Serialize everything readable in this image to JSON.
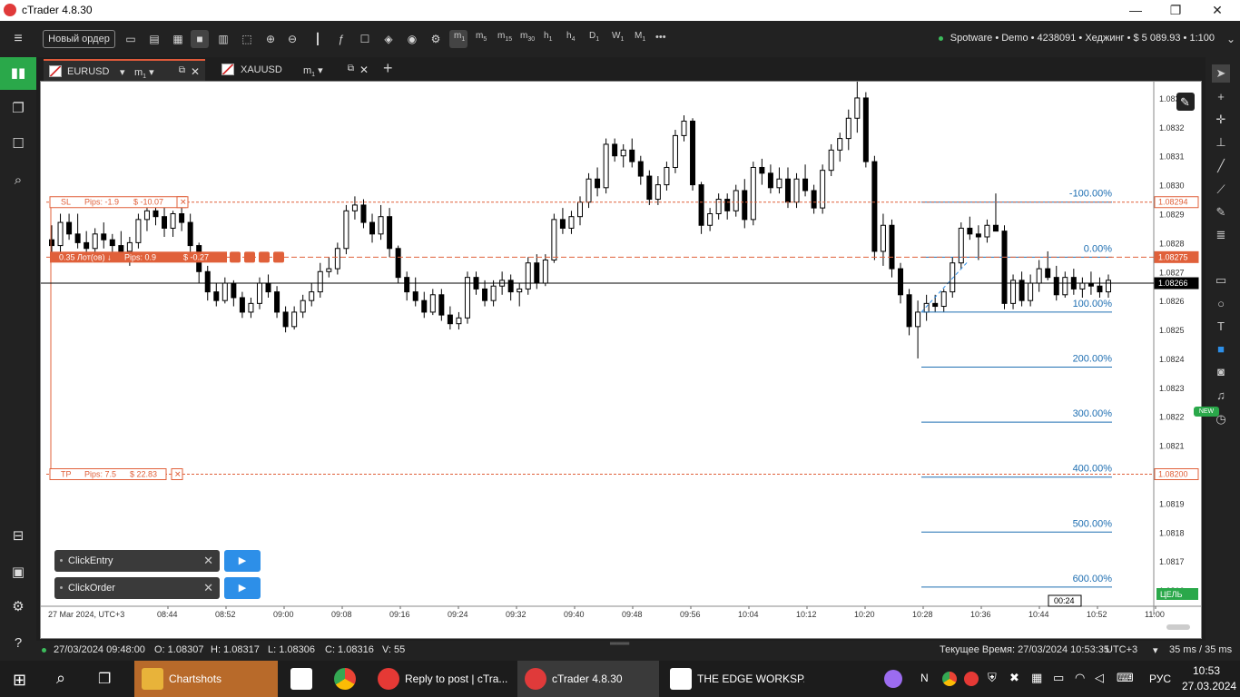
{
  "window": {
    "title": "cTrader 4.8.30",
    "minimize": "—",
    "maximize": "❐",
    "close": "✕"
  },
  "toolbar": {
    "new_order": "Новый ордер",
    "timeframes": [
      {
        "base": "m",
        "sub": "1"
      },
      {
        "base": "m",
        "sub": "5"
      },
      {
        "base": "m",
        "sub": "15"
      },
      {
        "base": "m",
        "sub": "30"
      },
      {
        "base": "h",
        "sub": "1"
      },
      {
        "base": "h",
        "sub": "4"
      },
      {
        "base": "D",
        "sub": "1"
      },
      {
        "base": "W",
        "sub": "1"
      },
      {
        "base": "M",
        "sub": "1"
      }
    ],
    "more": "•••",
    "account": "Spotware • Demo • 4238091 • Хеджинг • $ 5 089.93 • 1:100"
  },
  "tabs": [
    {
      "symbol": "EURUSD",
      "timeframe": "m",
      "timeframe_sub": "1",
      "active": true
    },
    {
      "symbol": "XAUUSD",
      "timeframe": "m",
      "timeframe_sub": "1",
      "active": false
    }
  ],
  "add_tab": "+",
  "chart_data": {
    "type": "candlestick",
    "symbol": "EURUSD",
    "timeframe": "m1",
    "ylim": [
      1.08155,
      1.08335
    ],
    "y_ticks": [
      "1.0833",
      "1.0832",
      "1.0831",
      "1.0830",
      "1.0829",
      "1.0828",
      "1.0827",
      "1.0826",
      "1.0825",
      "1.0824",
      "1.0823",
      "1.0822",
      "1.0821",
      "1.0820",
      "1.0819",
      "1.0818",
      "1.0817",
      "1.0816"
    ],
    "x_ticks": [
      "27 Mar 2024, UTC+3",
      "08:44",
      "08:52",
      "09:00",
      "09:08",
      "09:16",
      "09:24",
      "09:32",
      "09:40",
      "09:48",
      "09:56",
      "10:04",
      "10:12",
      "10:20",
      "10:28",
      "10:36",
      "10:44",
      "10:52",
      "11:00"
    ],
    "candles": [
      [
        1.08281,
        1.08286,
        1.08275,
        1.08279
      ],
      [
        1.08279,
        1.0829,
        1.08275,
        1.08287
      ],
      [
        1.08287,
        1.0829,
        1.08281,
        1.08283
      ],
      [
        1.08283,
        1.0829,
        1.08278,
        1.0828
      ],
      [
        1.0828,
        1.08284,
        1.08276,
        1.08278
      ],
      [
        1.08278,
        1.08285,
        1.08275,
        1.08283
      ],
      [
        1.08283,
        1.08287,
        1.08278,
        1.08281
      ],
      [
        1.08281,
        1.08283,
        1.08276,
        1.08279
      ],
      [
        1.08279,
        1.08284,
        1.08275,
        1.08277
      ],
      [
        1.08277,
        1.08282,
        1.08272,
        1.0828
      ],
      [
        1.0828,
        1.0829,
        1.08278,
        1.08288
      ],
      [
        1.08288,
        1.08294,
        1.08284,
        1.08291
      ],
      [
        1.08291,
        1.08294,
        1.08286,
        1.08289
      ],
      [
        1.08289,
        1.08293,
        1.08282,
        1.08285
      ],
      [
        1.08285,
        1.08291,
        1.08282,
        1.0829
      ],
      [
        1.0829,
        1.08294,
        1.08284,
        1.08287
      ],
      [
        1.08287,
        1.0829,
        1.08276,
        1.08279
      ],
      [
        1.08279,
        1.0828,
        1.08266,
        1.0827
      ],
      [
        1.0827,
        1.08272,
        1.0826,
        1.08263
      ],
      [
        1.08263,
        1.08266,
        1.08258,
        1.0826
      ],
      [
        1.0826,
        1.08268,
        1.08259,
        1.08266
      ],
      [
        1.08266,
        1.08267,
        1.08258,
        1.08261
      ],
      [
        1.08261,
        1.08263,
        1.08254,
        1.08256
      ],
      [
        1.08256,
        1.08261,
        1.08254,
        1.08259
      ],
      [
        1.08259,
        1.08268,
        1.08257,
        1.08266
      ],
      [
        1.08266,
        1.08269,
        1.08261,
        1.08263
      ],
      [
        1.08263,
        1.08265,
        1.08254,
        1.08256
      ],
      [
        1.08256,
        1.08258,
        1.08249,
        1.08251
      ],
      [
        1.08251,
        1.08258,
        1.0825,
        1.08256
      ],
      [
        1.08256,
        1.08262,
        1.08254,
        1.0826
      ],
      [
        1.0826,
        1.08266,
        1.08258,
        1.08263
      ],
      [
        1.08263,
        1.08273,
        1.08261,
        1.0827
      ],
      [
        1.0827,
        1.08275,
        1.08268,
        1.08271
      ],
      [
        1.08271,
        1.0828,
        1.08269,
        1.08278
      ],
      [
        1.08278,
        1.08293,
        1.08276,
        1.08291
      ],
      [
        1.08291,
        1.08296,
        1.08288,
        1.08293
      ],
      [
        1.08293,
        1.08295,
        1.08285,
        1.08287
      ],
      [
        1.08287,
        1.0829,
        1.0828,
        1.08283
      ],
      [
        1.08283,
        1.08293,
        1.08281,
        1.08289
      ],
      [
        1.08289,
        1.08292,
        1.08275,
        1.08278
      ],
      [
        1.08278,
        1.08279,
        1.08266,
        1.08268
      ],
      [
        1.08268,
        1.0827,
        1.0826,
        1.08263
      ],
      [
        1.08263,
        1.08268,
        1.08258,
        1.0826
      ],
      [
        1.0826,
        1.08263,
        1.08254,
        1.08256
      ],
      [
        1.08256,
        1.08264,
        1.08255,
        1.08262
      ],
      [
        1.08262,
        1.08264,
        1.08253,
        1.08255
      ],
      [
        1.08255,
        1.08258,
        1.0825,
        1.08252
      ],
      [
        1.08252,
        1.08256,
        1.0825,
        1.08254
      ],
      [
        1.08254,
        1.0827,
        1.08252,
        1.08268
      ],
      [
        1.08268,
        1.0827,
        1.08262,
        1.08264
      ],
      [
        1.08264,
        1.08267,
        1.08258,
        1.0826
      ],
      [
        1.0826,
        1.08267,
        1.08258,
        1.08265
      ],
      [
        1.08265,
        1.0827,
        1.08262,
        1.08267
      ],
      [
        1.08267,
        1.08269,
        1.0826,
        1.08263
      ],
      [
        1.08263,
        1.08266,
        1.08258,
        1.08264
      ],
      [
        1.08264,
        1.08275,
        1.08262,
        1.08273
      ],
      [
        1.08273,
        1.08276,
        1.08264,
        1.08266
      ],
      [
        1.08266,
        1.08276,
        1.08265,
        1.08274
      ],
      [
        1.08274,
        1.0829,
        1.08273,
        1.08288
      ],
      [
        1.08288,
        1.08292,
        1.08283,
        1.08285
      ],
      [
        1.08285,
        1.08291,
        1.08283,
        1.08289
      ],
      [
        1.08289,
        1.08296,
        1.08286,
        1.08294
      ],
      [
        1.08294,
        1.08304,
        1.08292,
        1.08302
      ],
      [
        1.08302,
        1.08306,
        1.08296,
        1.08299
      ],
      [
        1.08299,
        1.08316,
        1.08297,
        1.08314
      ],
      [
        1.08314,
        1.08316,
        1.08308,
        1.0831
      ],
      [
        1.0831,
        1.08314,
        1.08306,
        1.08312
      ],
      [
        1.08312,
        1.08316,
        1.08306,
        1.08308
      ],
      [
        1.08308,
        1.0831,
        1.083,
        1.08303
      ],
      [
        1.08303,
        1.08305,
        1.08293,
        1.08295
      ],
      [
        1.08295,
        1.08303,
        1.08293,
        1.083
      ],
      [
        1.083,
        1.08308,
        1.08298,
        1.08306
      ],
      [
        1.08306,
        1.08319,
        1.08304,
        1.08317
      ],
      [
        1.08317,
        1.08324,
        1.08315,
        1.08322
      ],
      [
        1.08322,
        1.08323,
        1.08298,
        1.083
      ],
      [
        1.083,
        1.08301,
        1.08283,
        1.08286
      ],
      [
        1.08286,
        1.08292,
        1.08284,
        1.0829
      ],
      [
        1.0829,
        1.08297,
        1.08288,
        1.08295
      ],
      [
        1.08295,
        1.08297,
        1.08288,
        1.08291
      ],
      [
        1.08291,
        1.083,
        1.08289,
        1.08298
      ],
      [
        1.08298,
        1.08302,
        1.08285,
        1.08288
      ],
      [
        1.08288,
        1.08308,
        1.08286,
        1.08306
      ],
      [
        1.08306,
        1.08309,
        1.083,
        1.08304
      ],
      [
        1.08304,
        1.08307,
        1.08297,
        1.08299
      ],
      [
        1.08299,
        1.08306,
        1.08297,
        1.08302
      ],
      [
        1.08302,
        1.08306,
        1.08292,
        1.08294
      ],
      [
        1.08294,
        1.08304,
        1.08292,
        1.08302
      ],
      [
        1.08302,
        1.08307,
        1.08296,
        1.08298
      ],
      [
        1.08298,
        1.083,
        1.0829,
        1.08292
      ],
      [
        1.08292,
        1.08307,
        1.0829,
        1.08305
      ],
      [
        1.08305,
        1.08314,
        1.08303,
        1.08312
      ],
      [
        1.08312,
        1.08318,
        1.08308,
        1.08316
      ],
      [
        1.08316,
        1.08326,
        1.08312,
        1.08323
      ],
      [
        1.08323,
        1.08336,
        1.08318,
        1.0833
      ],
      [
        1.0833,
        1.08332,
        1.08306,
        1.08308
      ],
      [
        1.08308,
        1.0831,
        1.08274,
        1.08277
      ],
      [
        1.08277,
        1.0829,
        1.08272,
        1.08286
      ],
      [
        1.08286,
        1.08288,
        1.08268,
        1.08271
      ],
      [
        1.08271,
        1.08273,
        1.08259,
        1.08262
      ],
      [
        1.08262,
        1.08264,
        1.08248,
        1.08251
      ],
      [
        1.08251,
        1.0826,
        1.0824,
        1.08256
      ],
      [
        1.08256,
        1.08262,
        1.08253,
        1.08259
      ],
      [
        1.08259,
        1.08262,
        1.08256,
        1.08258
      ],
      [
        1.08258,
        1.08264,
        1.08256,
        1.08263
      ],
      [
        1.08263,
        1.08275,
        1.08261,
        1.08273
      ],
      [
        1.08273,
        1.08287,
        1.08271,
        1.08285
      ],
      [
        1.08285,
        1.08289,
        1.08281,
        1.08283
      ],
      [
        1.08283,
        1.08286,
        1.08274,
        1.08282
      ],
      [
        1.08282,
        1.08288,
        1.0828,
        1.08286
      ],
      [
        1.08286,
        1.08297,
        1.08284,
        1.08284
      ],
      [
        1.08284,
        1.08286,
        1.08257,
        1.08259
      ],
      [
        1.08259,
        1.08269,
        1.08257,
        1.08267
      ],
      [
        1.08267,
        1.0827,
        1.08258,
        1.0826
      ],
      [
        1.0826,
        1.08269,
        1.08258,
        1.08266
      ],
      [
        1.08266,
        1.08274,
        1.08263,
        1.08271
      ],
      [
        1.08271,
        1.08277,
        1.08267,
        1.08268
      ],
      [
        1.08268,
        1.08272,
        1.0826,
        1.08262
      ],
      [
        1.08262,
        1.0827,
        1.08261,
        1.08268
      ],
      [
        1.08268,
        1.08271,
        1.08262,
        1.08264
      ],
      [
        1.08264,
        1.08268,
        1.08261,
        1.08266
      ],
      [
        1.08266,
        1.0827,
        1.08262,
        1.08265
      ],
      [
        1.08265,
        1.08268,
        1.08261,
        1.08263
      ],
      [
        1.08263,
        1.08269,
        1.08261,
        1.08267
      ]
    ],
    "current_price": "1.08266",
    "price_tags": {
      "sl": "1.08294",
      "entry": "1.08275",
      "tp": "1.08200",
      "current": "1.08266"
    },
    "sl_line": 1.08294,
    "entry_line": 1.08275,
    "tp_line": 1.082,
    "fib_levels": [
      {
        "label": "-100.00%",
        "price": 1.08294
      },
      {
        "label": "0.00%",
        "price": 1.08275
      },
      {
        "label": "100.00%",
        "price": 1.08256
      },
      {
        "label": "200.00%",
        "price": 1.08237
      },
      {
        "label": "300.00%",
        "price": 1.08218
      },
      {
        "label": "400.00%",
        "price": 1.08199
      },
      {
        "label": "500.00%",
        "price": 1.0818
      },
      {
        "label": "600.00%",
        "price": 1.08161
      }
    ],
    "sl_label": {
      "tag": "SL",
      "pips": "Pips: -1.9",
      "usd": "$ -10.07"
    },
    "entry_label": {
      "lots": "0.35 Лот(ов) ↓",
      "pips": "Pips: 0.9",
      "usd": "$ -0.27"
    },
    "tp_label": {
      "tag": "TP",
      "pips": "Pips: 7.5",
      "usd": "$ 22.83"
    },
    "countdown": "00:24",
    "target_tag": "ЦЕЛЬ"
  },
  "bots": [
    {
      "name": "ClickEntry"
    },
    {
      "name": "ClickOrder"
    }
  ],
  "status": {
    "bar_time": "27/03/2024 09:48:00",
    "open": "O: 1.08307",
    "high": "H: 1.08317",
    "low": "L: 1.08306",
    "close": "C: 1.08316",
    "volume": "V: 55",
    "server_time": "Текущее Время: 27/03/2024 10:53:35",
    "tz": "UTC+3",
    "latency": "35 ms / 35 ms"
  },
  "taskbar": {
    "apps": [
      {
        "title": "Chartshots",
        "color": "#e8b33a"
      },
      {
        "title": "",
        "color": "#ffffff"
      },
      {
        "title": "",
        "color": "#4caf50"
      },
      {
        "title": "Reply to post | cTra...",
        "color": "#e53935"
      },
      {
        "title": "cTrader 4.8.30",
        "color": "#e03a3a"
      },
      {
        "title": "THE EDGE WORKSP...",
        "color": "#ffffff"
      }
    ],
    "lang": "РУС",
    "time": "10:53",
    "date": "27.03.2024"
  }
}
